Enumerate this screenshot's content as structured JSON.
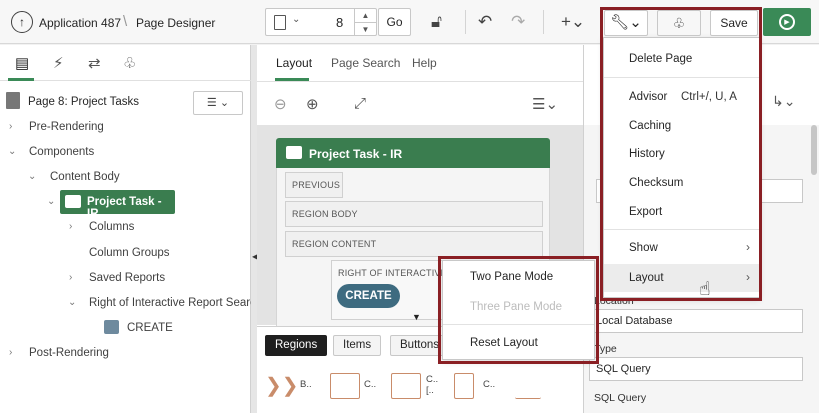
{
  "header": {
    "app_label": "Application 487",
    "designer_label": "Page Designer",
    "page_number": "8",
    "go_label": "Go",
    "save_label": "Save",
    "run_icon": "run-icon"
  },
  "left_panel": {
    "page_title": "Page 8: Project Tasks",
    "tree": {
      "pre_rendering": "Pre-Rendering",
      "components": "Components",
      "content_body": "Content Body",
      "project_task_ir": "Project Task - IR",
      "columns": "Columns",
      "column_groups": "Column Groups",
      "saved_reports": "Saved Reports",
      "right_of_ir_search": "Right of Interactive Report Search",
      "create": "CREATE",
      "post_rendering": "Post-Rendering"
    }
  },
  "middle_panel": {
    "tabs": [
      "Layout",
      "Page Search",
      "Help"
    ],
    "region_title": "Project Task - IR",
    "slots": {
      "previous": "PREVIOUS",
      "region_body": "REGION BODY",
      "region_content": "REGION CONTENT",
      "right_of_ir": "RIGHT OF INTERACTIVE R"
    },
    "create_button": "CREATE",
    "bottom_tabs": [
      "Regions",
      "Items",
      "Buttons"
    ],
    "gallery": [
      "B..",
      "C..",
      "C..\n[..",
      "C.."
    ]
  },
  "right_panel": {
    "location_label": "Location",
    "location_value": "Local Database",
    "type_label": "Type",
    "type_value": "SQL Query",
    "sql_label": "SQL Query"
  },
  "utilities_menu": {
    "delete_page": "Delete Page",
    "advisor": "Advisor",
    "advisor_shortcut": "Ctrl+/, U, A",
    "caching": "Caching",
    "history": "History",
    "checksum": "Checksum",
    "export": "Export",
    "show": "Show",
    "layout": "Layout"
  },
  "layout_submenu": {
    "two_pane": "Two Pane Mode",
    "three_pane": "Three Pane Mode",
    "reset": "Reset Layout"
  },
  "colors": {
    "accent_green": "#3a8a57",
    "highlight_box": "#8a1f24",
    "create_button": "#3e6b80"
  }
}
